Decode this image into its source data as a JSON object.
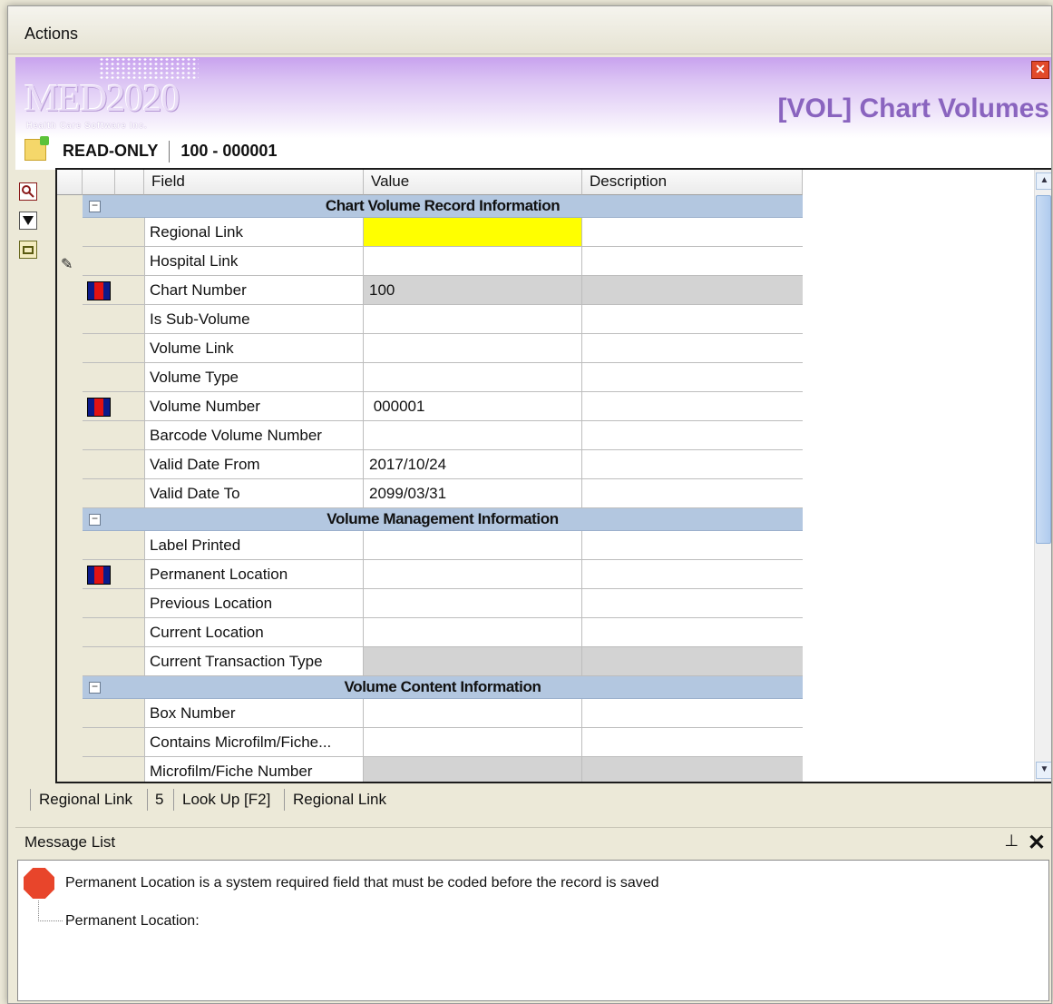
{
  "menu": {
    "actions_label": "Actions"
  },
  "header": {
    "logo_text": "MED2020",
    "logo_subtitle": "Health Care Software Inc.",
    "title": "[VOL] Chart Volumes",
    "mode": "READ-ONLY",
    "record_id": "100 -  000001"
  },
  "grid": {
    "columns": {
      "field": "Field",
      "value": "Value",
      "description": "Description"
    },
    "sections": [
      {
        "label": "Chart Volume Record Information"
      },
      {
        "label": "Volume Management Information"
      },
      {
        "label": "Volume Content Information"
      }
    ],
    "rows": [
      {
        "field": "Regional Link",
        "value": ""
      },
      {
        "field": "Hospital Link",
        "value": ""
      },
      {
        "field": "Chart Number",
        "value": "100"
      },
      {
        "field": "Is Sub-Volume",
        "value": ""
      },
      {
        "field": "Volume Link",
        "value": ""
      },
      {
        "field": "Volume Type",
        "value": ""
      },
      {
        "field": "Volume Number",
        "value": " 000001"
      },
      {
        "field": "Barcode Volume Number",
        "value": ""
      },
      {
        "field": "Valid Date From",
        "value": "2017/10/24"
      },
      {
        "field": "Valid Date To",
        "value": "2099/03/31"
      },
      {
        "field": "Label Printed",
        "value": ""
      },
      {
        "field": "Permanent Location",
        "value": ""
      },
      {
        "field": "Previous Location",
        "value": ""
      },
      {
        "field": "Current Location",
        "value": ""
      },
      {
        "field": "Current Transaction Type",
        "value": ""
      },
      {
        "field": "Box Number",
        "value": ""
      },
      {
        "field": "Contains Microfilm/Fiche...",
        "value": ""
      },
      {
        "field": "Microfilm/Fiche Number",
        "value": ""
      }
    ]
  },
  "status_bar": {
    "field_name": "Regional Link",
    "field_length": "5",
    "lookup": "Look Up [F2]",
    "description": "Regional Link"
  },
  "message_list": {
    "title": "Message List",
    "messages": [
      {
        "text": "Permanent Location is a system required field that must be coded before the record is saved",
        "detail": "Permanent Location:"
      }
    ]
  },
  "icons": {
    "close": "close-icon",
    "pin": "pin-icon",
    "stop": "stop-icon",
    "required": "required-field-icon"
  },
  "colors": {
    "header_accent": "#8a64bf",
    "section_band": "#b3c7e0",
    "active_cell": "#ffff00",
    "readonly_cell": "#d3d3d3",
    "error": "#e8452b"
  }
}
